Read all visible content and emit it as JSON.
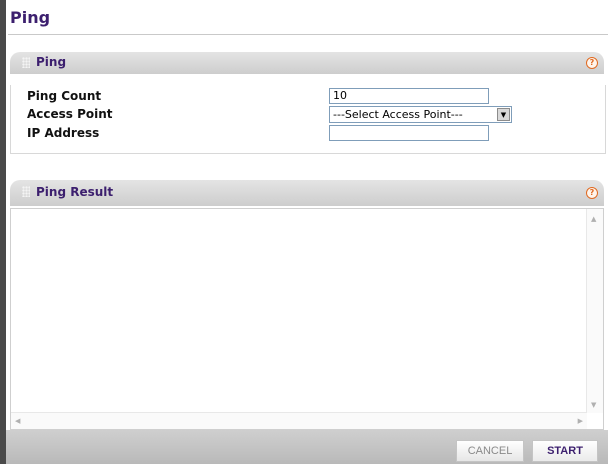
{
  "page": {
    "title": "Ping"
  },
  "ping_section": {
    "title": "Ping",
    "help": "?",
    "fields": [
      {
        "label": "Ping Count",
        "value": "10"
      },
      {
        "label": "Access Point",
        "value": "---Select Access Point---"
      },
      {
        "label": "IP Address",
        "value": ""
      }
    ]
  },
  "result_section": {
    "title": "Ping Result",
    "help": "?",
    "content": ""
  },
  "footer": {
    "cancel_label": "CANCEL",
    "start_label": "START"
  },
  "icons": {
    "help": "help-icon",
    "dropdown": "chevron-down-icon",
    "grip": "grip-icon"
  },
  "colors": {
    "title": "#3c1f6e",
    "help": "#e06a22",
    "footer_bg": "#c2c2c2"
  }
}
